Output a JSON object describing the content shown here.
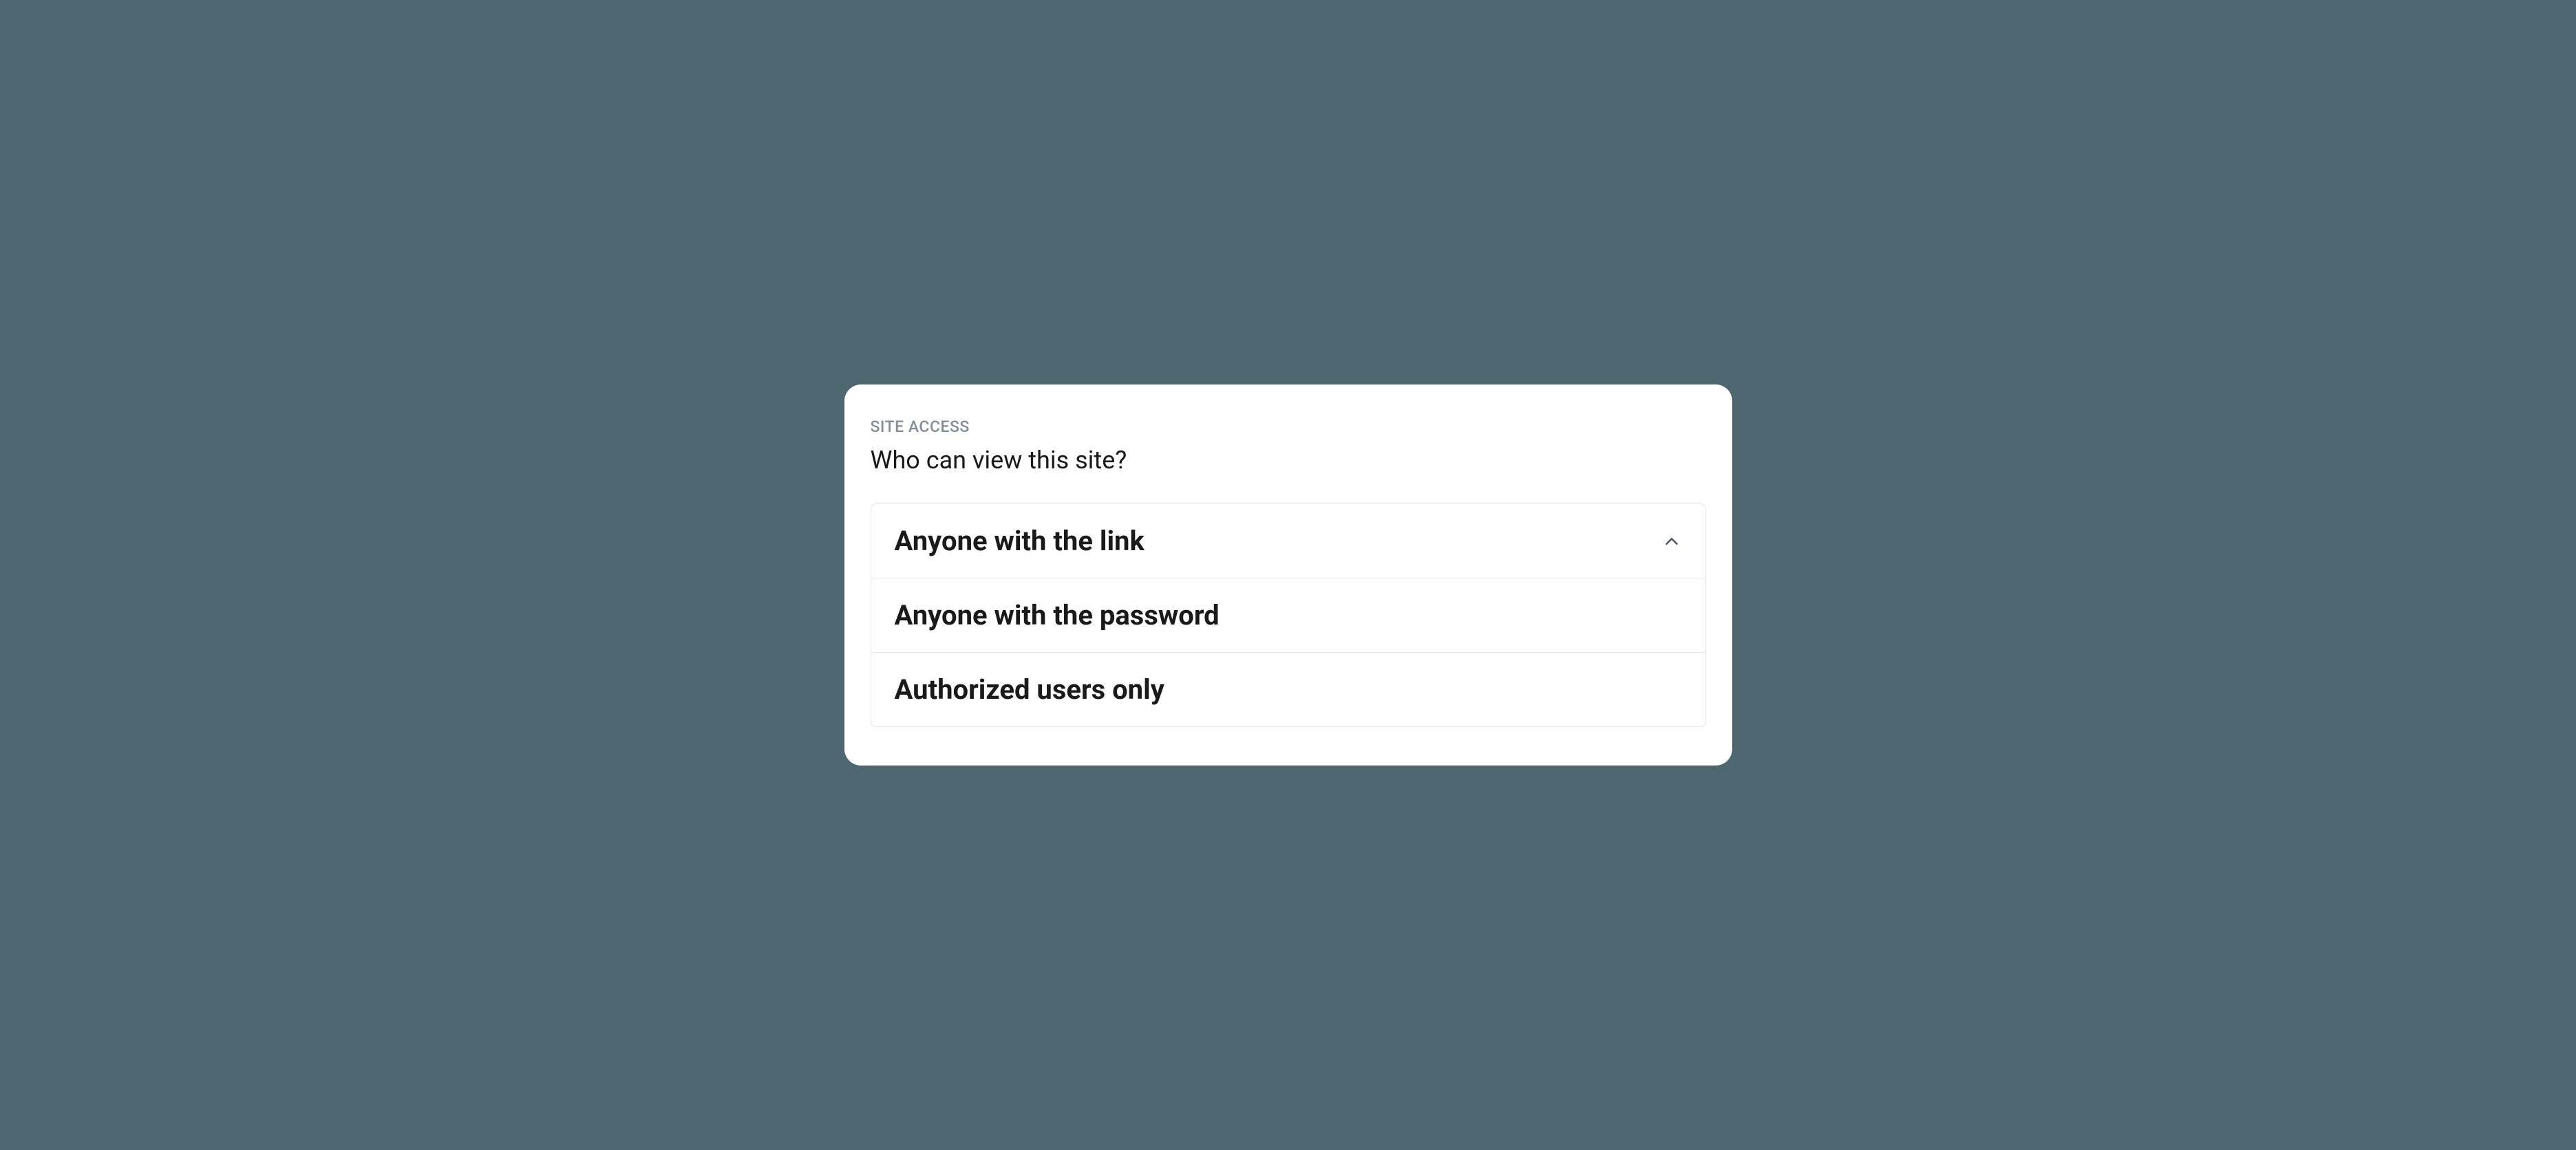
{
  "section": {
    "label": "SITE ACCESS",
    "title": "Who can view this site?"
  },
  "dropdown": {
    "options": [
      {
        "label": "Anyone with the link",
        "selected": true
      },
      {
        "label": "Anyone with the password",
        "selected": false
      },
      {
        "label": "Authorized users only",
        "selected": false
      }
    ]
  }
}
